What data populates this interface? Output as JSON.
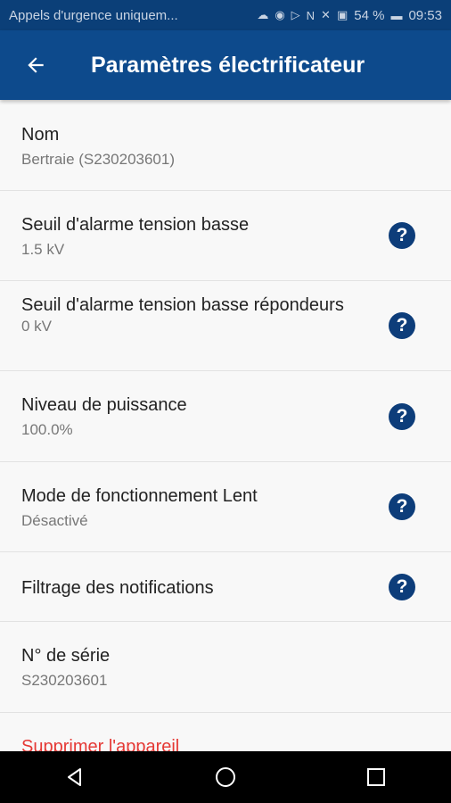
{
  "status_bar": {
    "carrier": "Appels d'urgence uniquem...",
    "battery": "54 %",
    "time": "09:53",
    "icons": [
      "cloud-icon",
      "sync-icon",
      "play-icon",
      "nfc-icon",
      "mute-icon",
      "battery-saver-icon",
      "battery-icon"
    ]
  },
  "header": {
    "title": "Paramètres électrificateur",
    "back_icon": "arrow-back-icon"
  },
  "settings": [
    {
      "label": "Nom",
      "value": "Bertraie (S230203601)",
      "help": false
    },
    {
      "label": "Seuil d'alarme tension basse",
      "value": "1.5 kV",
      "help": true
    },
    {
      "label": "Seuil d'alarme tension basse répondeurs",
      "value": "0 kV",
      "help": true
    },
    {
      "label": "Niveau de puissance",
      "value": "100.0%",
      "help": true
    },
    {
      "label": "Mode de fonctionnement Lent",
      "value": "Désactivé",
      "help": true
    },
    {
      "label": "Filtrage des notifications",
      "value": "",
      "help": true
    },
    {
      "label": "N° de série",
      "value": "S230203601",
      "help": false
    }
  ],
  "help_symbol": "?",
  "delete_label": "Supprimer l'appareil",
  "colors": {
    "appbar": "#0d4a8c",
    "statusbar": "#0b3f78",
    "help_icon": "#0d3d7a",
    "danger": "#e53935"
  },
  "nav": [
    "back-nav-icon",
    "home-nav-icon",
    "recents-nav-icon"
  ]
}
